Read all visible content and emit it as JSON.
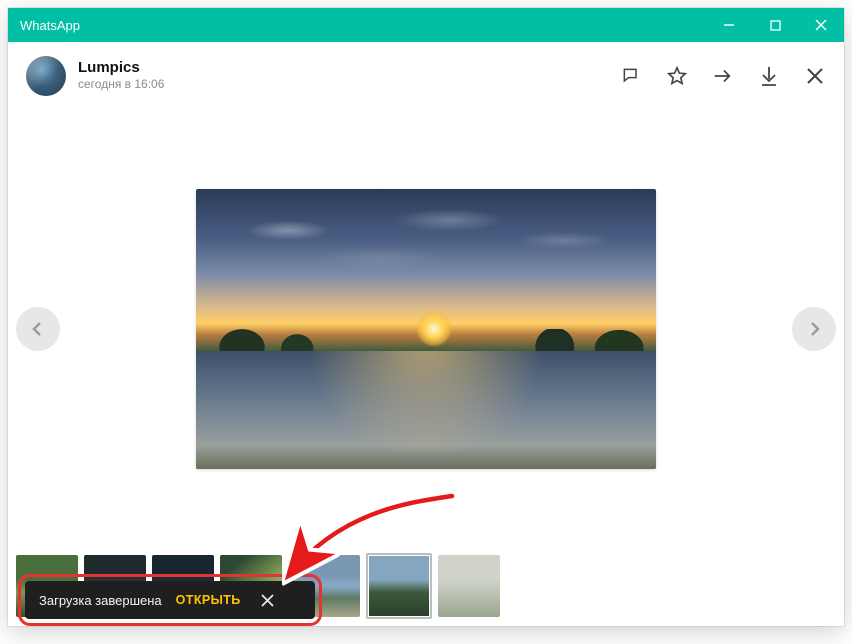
{
  "window": {
    "title": "WhatsApp"
  },
  "header": {
    "name": "Lumpics",
    "time": "сегодня в 16:06"
  },
  "toast": {
    "status": "Загрузка завершена",
    "open": "ОТКРЫТЬ"
  }
}
